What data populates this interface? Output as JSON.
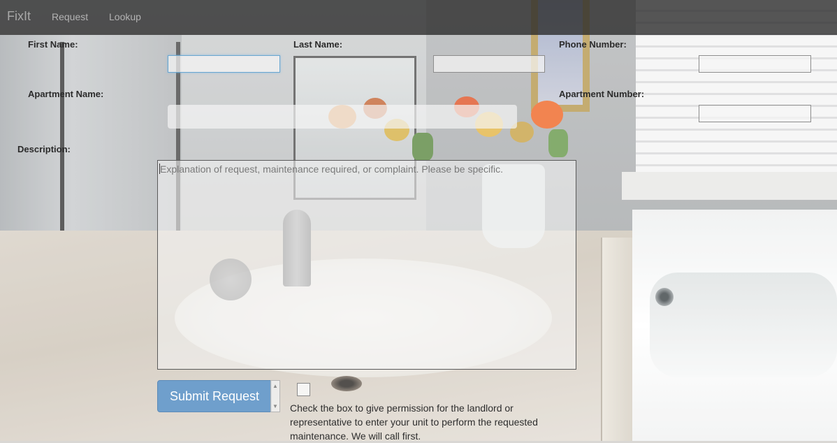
{
  "navbar": {
    "brand": "FixIt",
    "links": {
      "request": "Request",
      "lookup": "Lookup"
    }
  },
  "form": {
    "first_name": {
      "label": "First Name:",
      "value": ""
    },
    "last_name": {
      "label": "Last Name:",
      "value": ""
    },
    "phone_number": {
      "label": "Phone Number:",
      "value": ""
    },
    "apartment_name": {
      "label": "Apartment Name:",
      "value": ""
    },
    "apartment_number": {
      "label": "Apartment Number:",
      "value": ""
    },
    "description": {
      "label": "Description:",
      "placeholder": "Explanation of request, maintenance required, or complaint. Please be specific."
    },
    "submit_label": "Submit Request",
    "permission": {
      "checked": false,
      "text": "Check the box to give permission for the landlord or representative to enter your unit to perform the requested maintenance. We will call first."
    }
  },
  "colors": {
    "navbar_bg": "#282828",
    "submit_button": "#6f9fcc",
    "focus_border": "#6aa6d0"
  }
}
